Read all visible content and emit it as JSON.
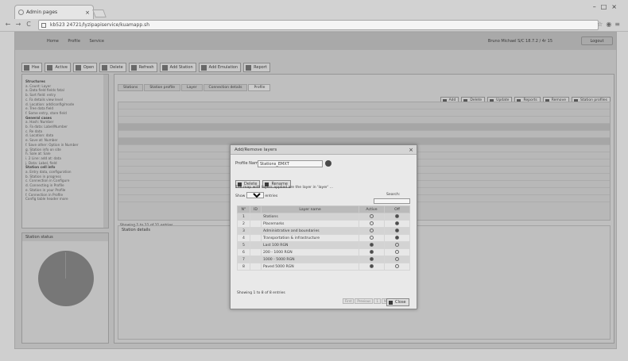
{
  "browser": {
    "tab_title": "Admin pages",
    "url": "kb523 24721/lyzipapiservice/kuamapp.sh",
    "nav": {
      "back": "←",
      "forward": "→",
      "reload": "C"
    }
  },
  "app": {
    "menu": "Home  Profile  Service",
    "user": "Bruno Michael S/C 18.7.2 / 4r 15",
    "logout": "Logout",
    "toolbar": [
      "Hse",
      "Active",
      "Open",
      "Delete",
      "Refresh",
      "Add Station",
      "Add Emulation",
      "Report"
    ],
    "tree": [
      "Structures",
      "a. Count: Layer",
      "a. Data field fields fatal",
      "b. Sort field: entry",
      "c. Fa details view level",
      "d. Location: add/config/mode",
      "e. Tree data field",
      "f. Some entry, store field",
      "General cases",
      "a. Hash: Number",
      "b. Fa data: Label/Number",
      "c. Re data",
      "d. Location: data",
      "e. Save at: Number",
      "f. Save other: Option in Number",
      "g. Station info on site",
      "h. Sale at: Sale",
      "i. 2 Line: add at: data",
      "j. Data: Label, field",
      "Station cell info",
      "a. Entry data, configuration",
      "b. Station in progress",
      "c. Connection in Configure",
      "d. Connecting in Profile",
      "e. Station in your Profile",
      "f. Connection in Profile",
      "Config table header more"
    ],
    "chart_panel_title": "Station status",
    "main_tabs": [
      "Stations",
      "Station profile",
      "Layer",
      "Connection details",
      "Profile"
    ],
    "grid_buttons": [
      "Add",
      "Delete",
      "Update",
      "Reports",
      "Remove",
      "Station profiles"
    ],
    "grid_showing": "Showing 1 to 11 of 11 entries",
    "lower_panel_title": "Station details"
  },
  "modal": {
    "title": "Add/Remove layers",
    "close": "×",
    "name_label": "Profile Name:",
    "name_value": "Stations_EMXT",
    "buttons": [
      "Delete",
      "Rename"
    ],
    "description": "The map with layers applied are the layer in 'layer' ...",
    "show_label_before": "Show",
    "show_value": "10",
    "show_label_after": "entries",
    "search_label": "Search:",
    "columns": [
      "N°",
      "ID",
      "Layer name",
      "Active",
      "Off"
    ],
    "rows": [
      {
        "n": "1",
        "name": "Stations",
        "active": false,
        "off": true
      },
      {
        "n": "2",
        "name": "Placemarks",
        "active": false,
        "off": true
      },
      {
        "n": "3",
        "name": "Administrative and boundaries",
        "active": false,
        "off": true
      },
      {
        "n": "4",
        "name": "Transportation & infrastructure",
        "active": false,
        "off": true
      },
      {
        "n": "5",
        "name": "Last 100 RGN",
        "active": true,
        "off": false
      },
      {
        "n": "6",
        "name": "200 - 1000 RGN",
        "active": true,
        "off": false
      },
      {
        "n": "7",
        "name": "1000 - 5000 RGN",
        "active": true,
        "off": false
      },
      {
        "n": "8",
        "name": "Paved 5000 RGN",
        "active": true,
        "off": false
      }
    ],
    "footer": "Showing 1 to 8 of 8 entries",
    "pager": [
      "First",
      "Previous",
      "1",
      "Next",
      "Last"
    ],
    "close_button": "Close"
  }
}
